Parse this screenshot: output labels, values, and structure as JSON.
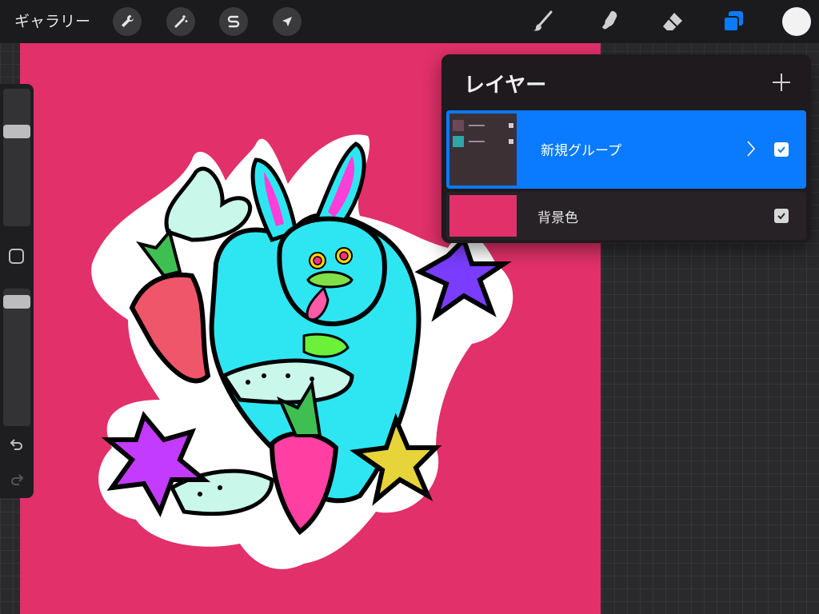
{
  "toolbar": {
    "gallery_label": "ギャラリー",
    "tools_left": [
      "wrench-icon",
      "magic-wand-icon",
      "selection-s-icon",
      "transform-arrow-icon"
    ],
    "tools_right": [
      "brush-icon",
      "smudge-icon",
      "eraser-icon",
      "layers-icon"
    ],
    "active_color": "#f2f2f2",
    "accent": "#0a7aff"
  },
  "sidebar": {
    "brush_size_level": 0.29,
    "opacity_level": 0.05
  },
  "layers_panel": {
    "title": "レイヤー",
    "add_icon": "plus-icon",
    "layers": [
      {
        "name": "新規グループ",
        "selected": true,
        "visible": true,
        "is_group": true
      },
      {
        "name": "背景色",
        "selected": false,
        "visible": true,
        "color": "#e2306a"
      }
    ]
  },
  "canvas": {
    "background_color": "#e2306a"
  }
}
